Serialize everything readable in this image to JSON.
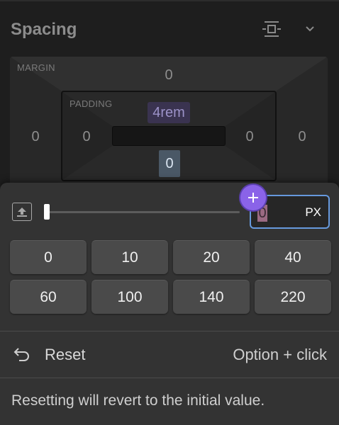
{
  "panel": {
    "title": "Spacing",
    "icons": {
      "spacing_toggle": "split-spacing-icon",
      "collapse": "chevron-down-icon"
    }
  },
  "box_model": {
    "margin_label": "MARGIN",
    "margin": {
      "top": "0",
      "right": "0",
      "bottom": "",
      "left": "0"
    },
    "padding_label": "PADDING",
    "padding": {
      "top": "4rem",
      "right": "0",
      "bottom": "0",
      "left": "0"
    }
  },
  "popover": {
    "slider_value": 0,
    "input": {
      "value": "0",
      "unit": "PX"
    },
    "presets": [
      "0",
      "10",
      "20",
      "40",
      "60",
      "100",
      "140",
      "220"
    ],
    "reset": {
      "label": "Reset",
      "shortcut": "Option + click"
    },
    "hint": "Resetting will revert to the initial value."
  },
  "colors": {
    "accent": "#8a63e8",
    "focus_border": "#6699dd",
    "padding_top_chip": "#3a3350",
    "padding_bottom_chip": "#4a5866"
  }
}
